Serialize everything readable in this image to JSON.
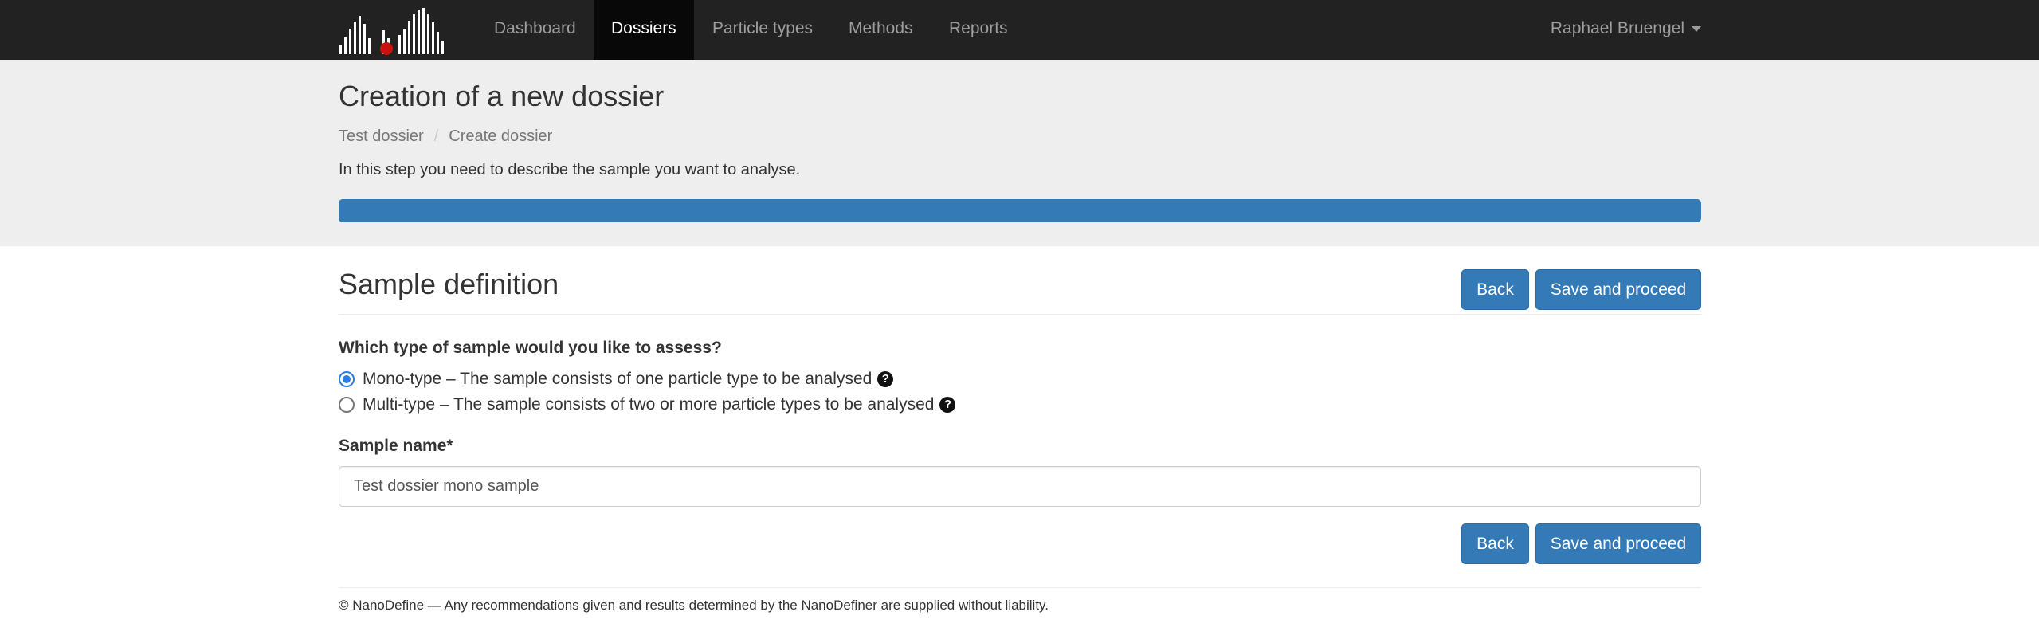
{
  "brand": {
    "logo_icon": "bar-histogram-logo",
    "logo_accent": "#cc1111"
  },
  "nav": {
    "items": [
      {
        "label": "Dashboard"
      },
      {
        "label": "Dossiers"
      },
      {
        "label": "Particle types"
      },
      {
        "label": "Methods"
      },
      {
        "label": "Reports"
      }
    ],
    "active": "Dossiers",
    "user": "Raphael Bruengel"
  },
  "header": {
    "title": "Creation of a new dossier",
    "breadcrumb": [
      "Test dossier",
      "Create dossier"
    ],
    "intro": "In this step you need to describe the sample you want to analyse.",
    "progress_fraction": 1.0,
    "progress_color": "#337ab7"
  },
  "form": {
    "section_title": "Sample definition",
    "back_label": "Back",
    "save_label": "Save and proceed",
    "question": "Which type of sample would you like to assess?",
    "options": [
      {
        "label": "Mono-type – The sample consists of one particle type to be analysed",
        "checked": true
      },
      {
        "label": "Multi-type – The sample consists of two or more particle types to be analysed",
        "checked": false
      }
    ],
    "help_icon": "question-circle-icon",
    "name_label": "Sample name*",
    "name_value": "Test dossier mono sample"
  },
  "footer": {
    "text": "© NanoDefine — Any recommendations given and results determined by the NanoDefiner are supplied without liability."
  }
}
